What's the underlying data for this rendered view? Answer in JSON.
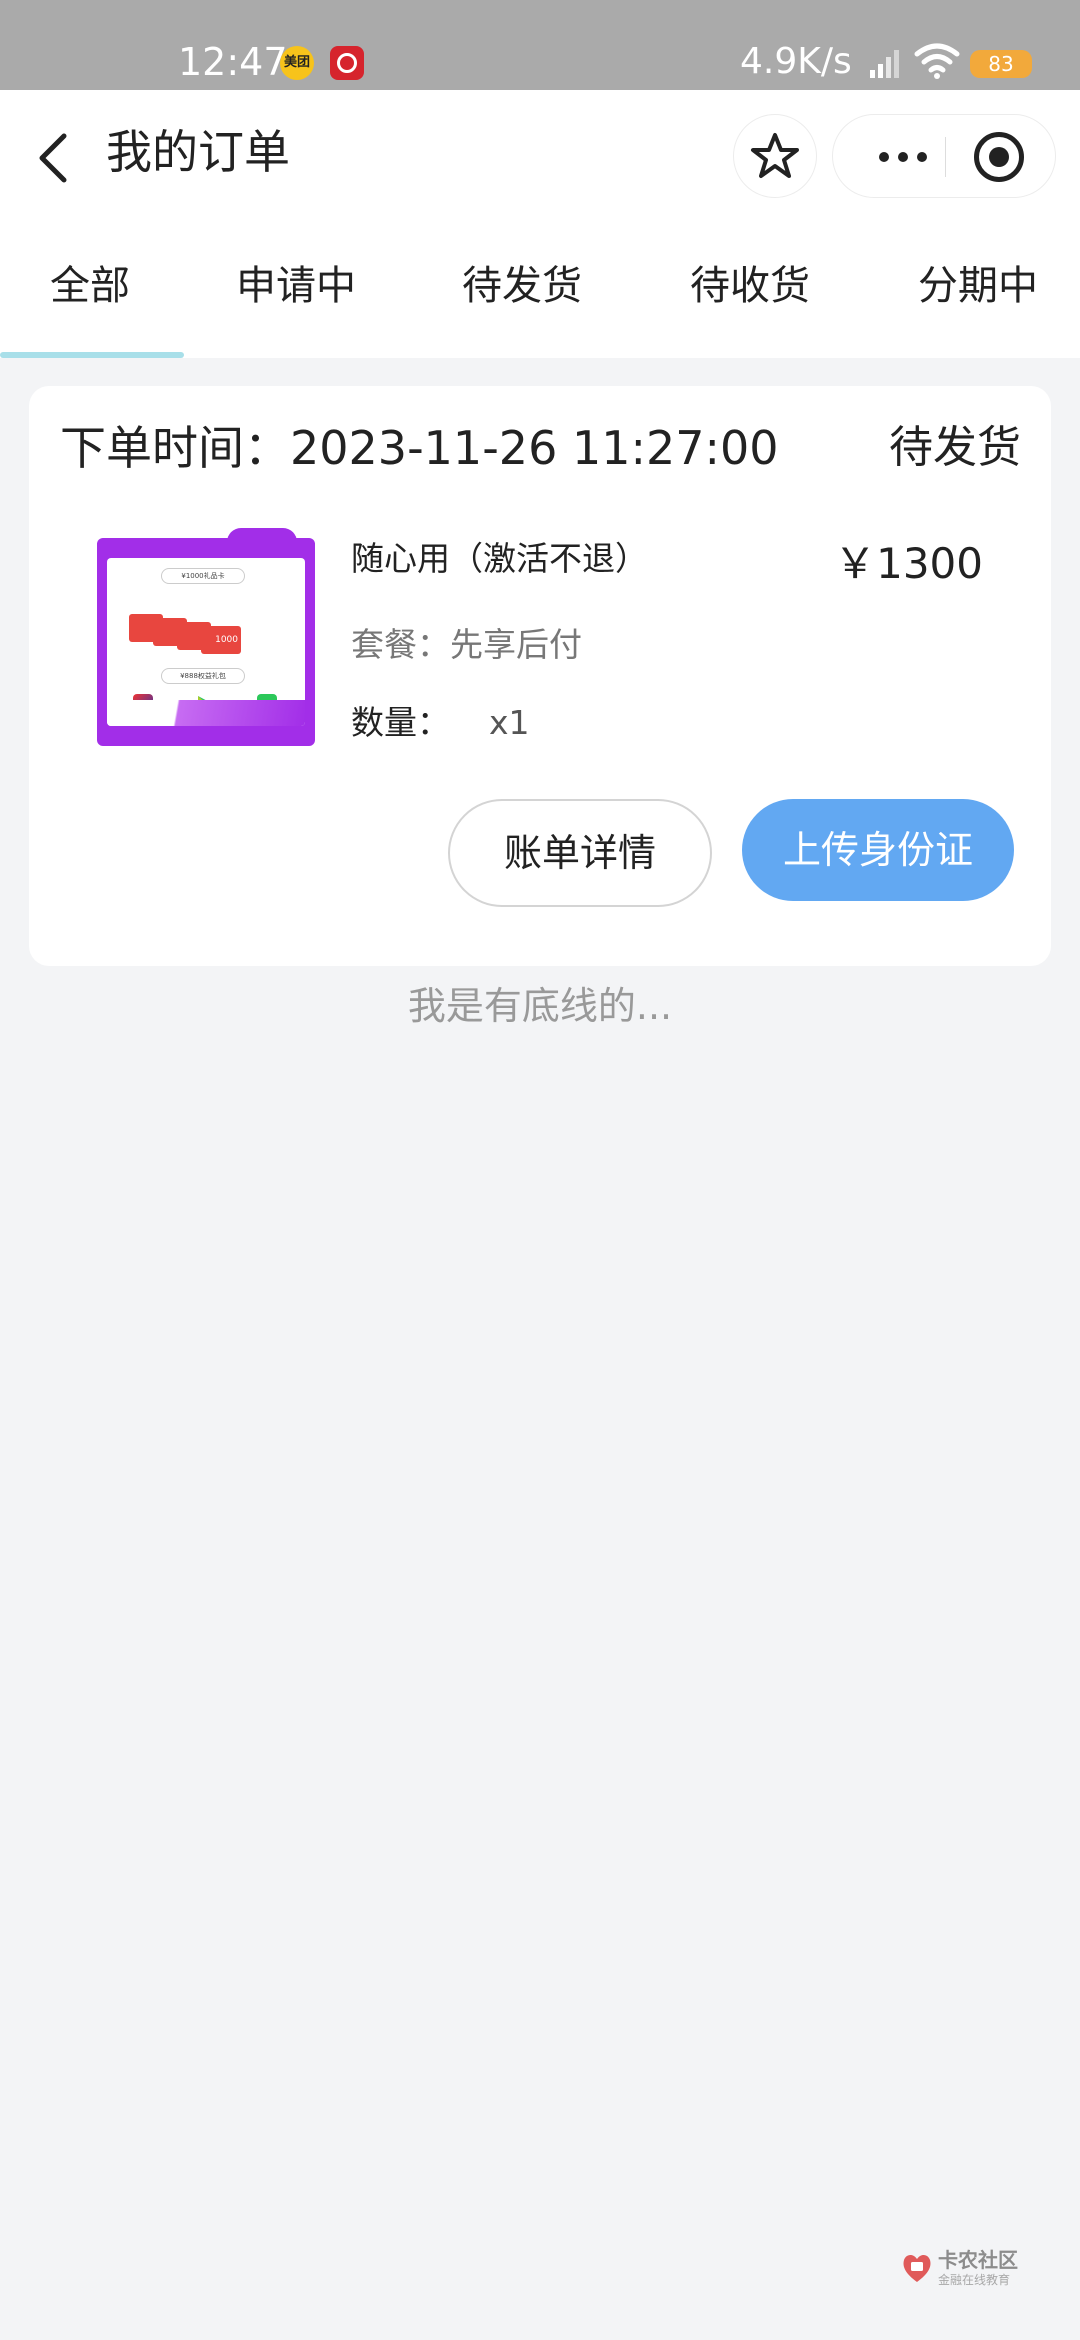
{
  "status_bar": {
    "time": "12:47",
    "meituan_badge": "美团",
    "network_speed": "4.9K/s",
    "battery": "83"
  },
  "header": {
    "title": "我的订单"
  },
  "tabs": [
    {
      "label": "全部",
      "active": true
    },
    {
      "label": "申请中",
      "active": false
    },
    {
      "label": "待发货",
      "active": false
    },
    {
      "label": "待收货",
      "active": false
    },
    {
      "label": "分期中",
      "active": false
    }
  ],
  "order": {
    "time_label": "下单时间：2023-11-26 11:27:00",
    "status": "待发货",
    "product": {
      "image_caption_top": "¥1000礼品卡",
      "image_caption_bottom": "¥888权益礼包",
      "image_card_value": "1000",
      "name": "随心用（激活不退）",
      "price": "￥1300",
      "package": "套餐：先享后付",
      "quantity_label": "数量：",
      "quantity": "x1"
    },
    "actions": {
      "bill_details": "账单详情",
      "upload_id": "上传身份证"
    }
  },
  "footer": {
    "bottom_line": "我是有底线的..."
  },
  "watermark": {
    "title": "卡农社区",
    "subtitle": "金融在线教育"
  },
  "colors": {
    "primary_button": "#62a8f2",
    "tab_indicator": "#a8dfe9",
    "product_purple": "#a22ee8",
    "page_background": "#f3f4f6"
  }
}
